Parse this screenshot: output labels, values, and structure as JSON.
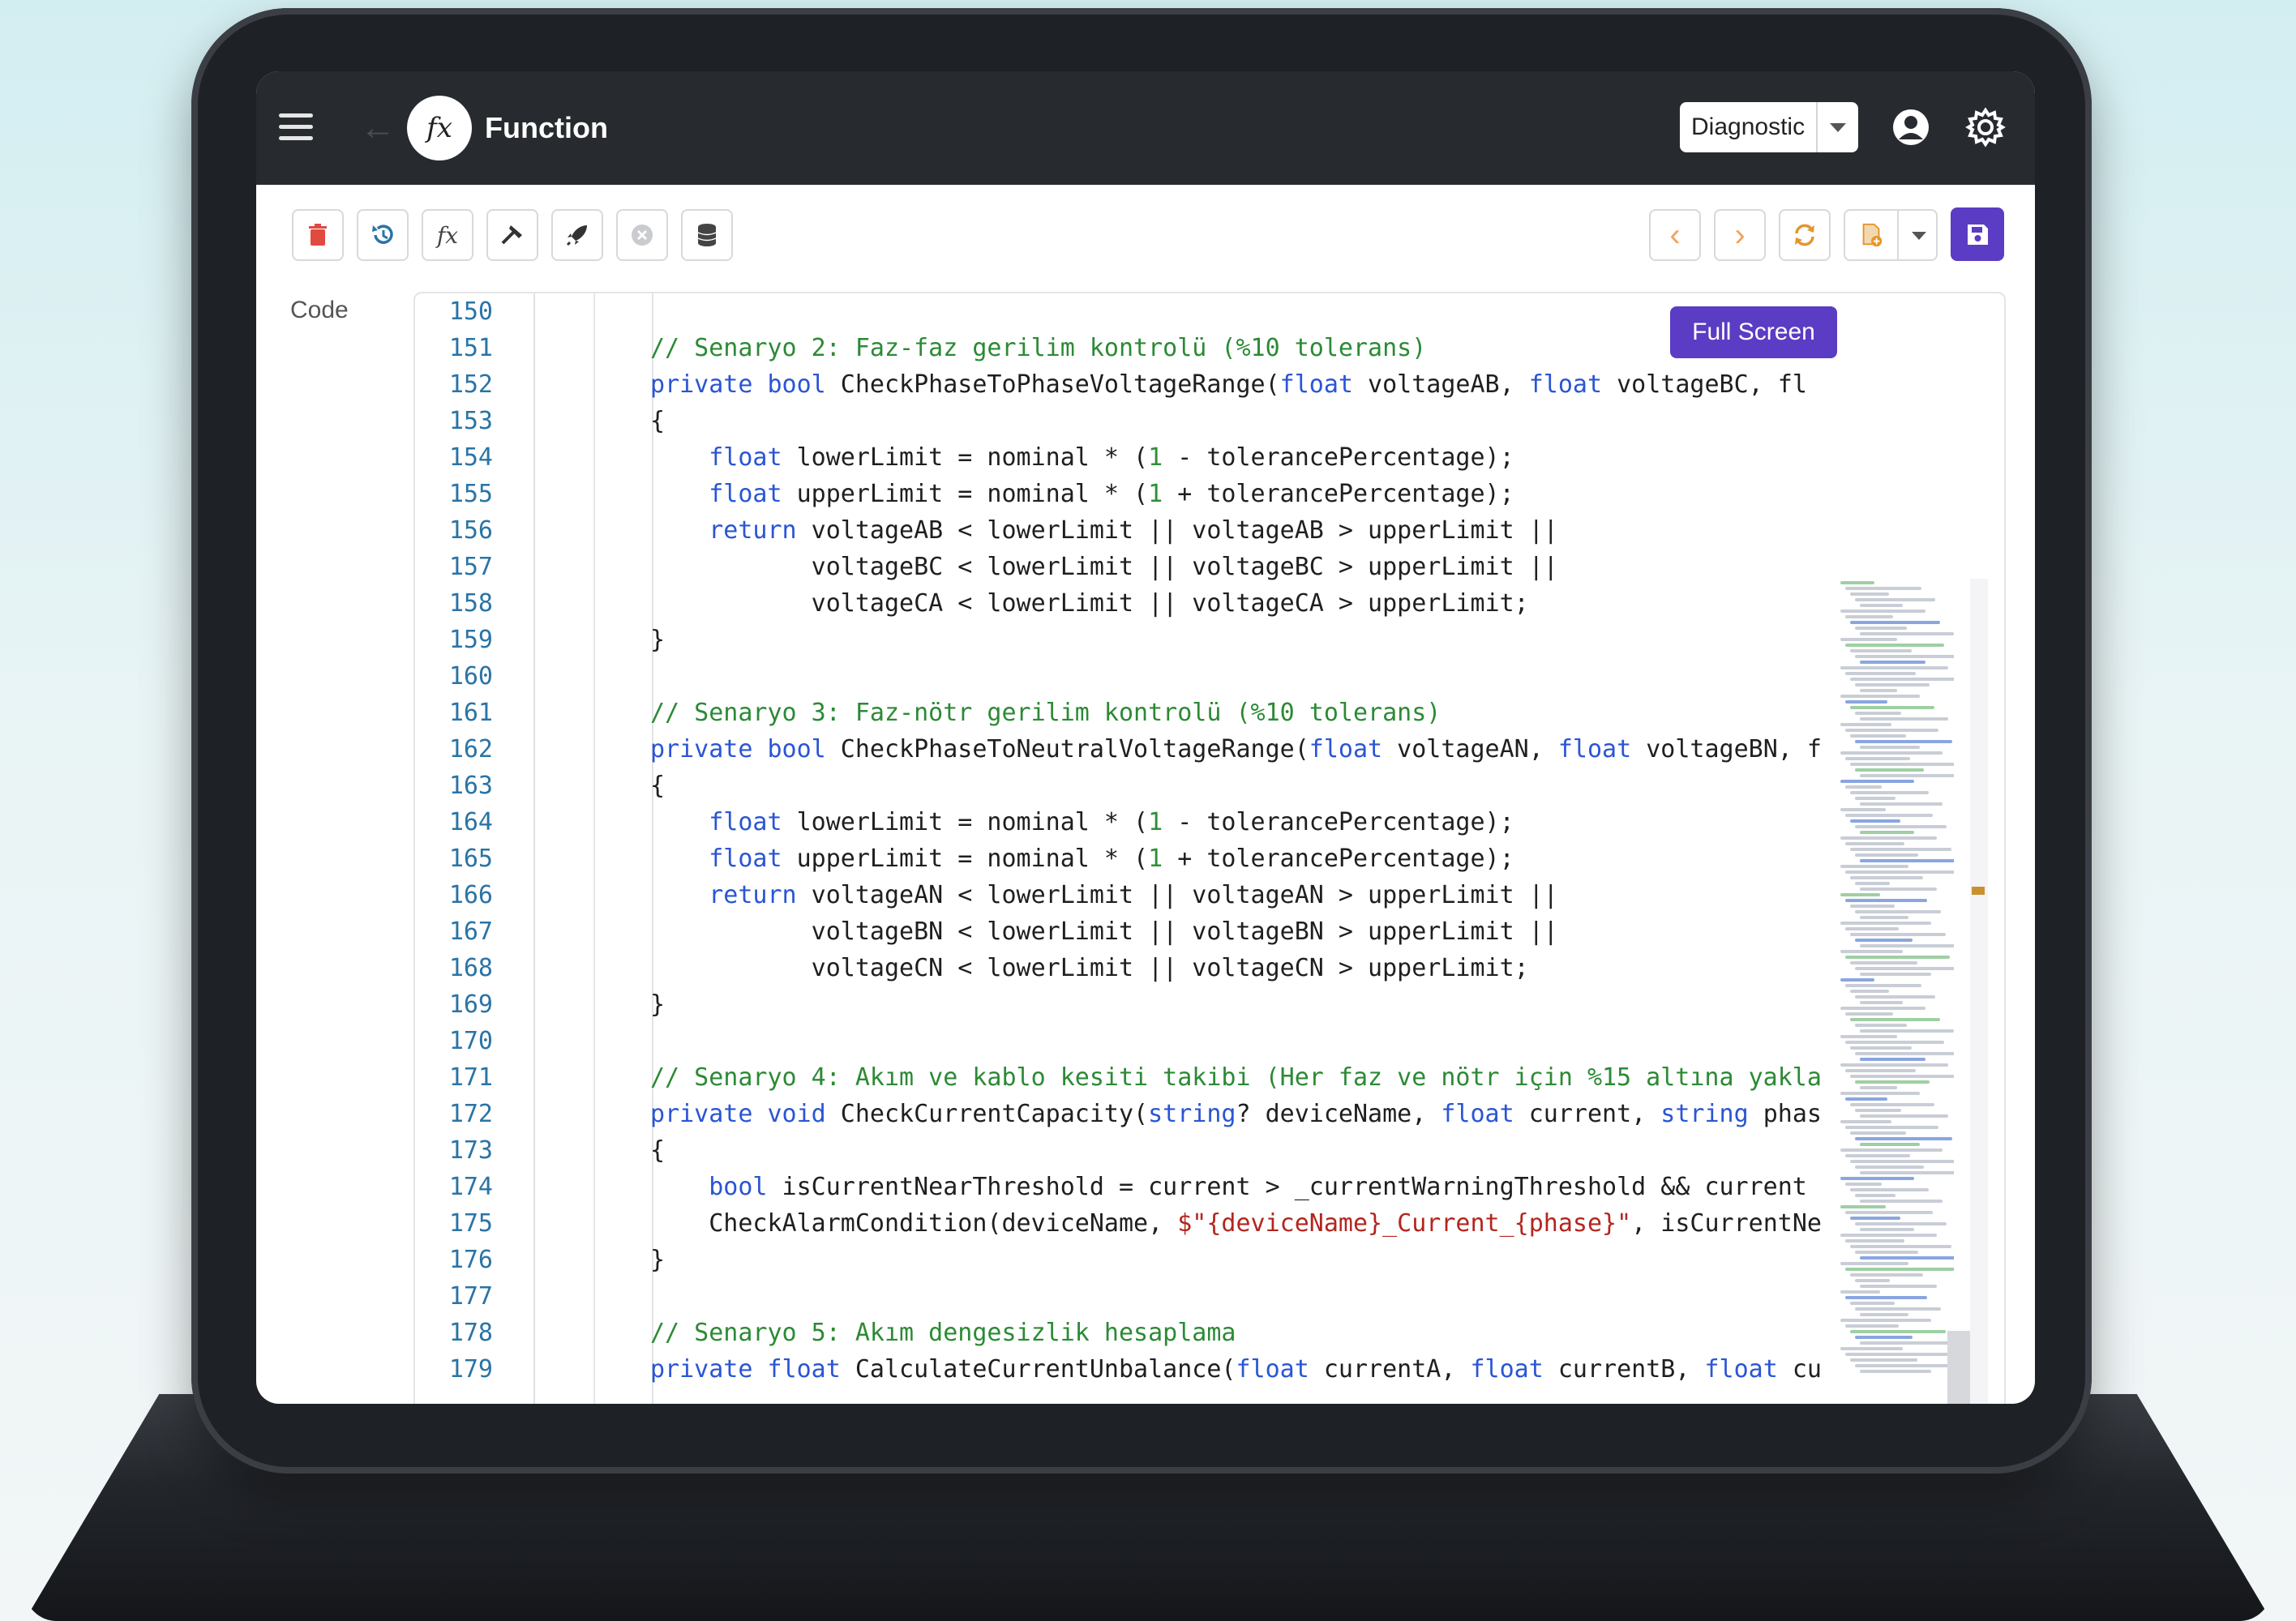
{
  "app": {
    "title": "Function",
    "logo_text": "fx"
  },
  "header": {
    "mode_selector": {
      "value": "Diagnostic"
    }
  },
  "toolbar": {
    "left_buttons": [
      "delete-icon",
      "undo-icon",
      "function-icon",
      "hammer-icon",
      "rocket-icon",
      "cancel-icon",
      "database-icon"
    ],
    "right_buttons": [
      "previous-icon",
      "next-icon",
      "refresh-icon",
      "add-file-icon",
      "save-icon"
    ],
    "colors": {
      "delete": "#e04a3f",
      "undo": "#2a74a6",
      "nav": "#f0a35c",
      "save": "#5b3cc4"
    }
  },
  "editor": {
    "label": "Code",
    "fullscreen_label": "Full Screen",
    "lines": [
      {
        "num": "150",
        "text": ""
      },
      {
        "num": "151",
        "text": "// Senaryo 2: Faz-faz gerilim kontrolü (%10 tolerans)"
      },
      {
        "num": "152",
        "text": "private bool CheckPhaseToPhaseVoltageRange(float voltageAB, float voltageBC, fl"
      },
      {
        "num": "153",
        "text": "{"
      },
      {
        "num": "154",
        "text": "    float lowerLimit = nominal * (1 - tolerancePercentage);"
      },
      {
        "num": "155",
        "text": "    float upperLimit = nominal * (1 + tolerancePercentage);"
      },
      {
        "num": "156",
        "text": "    return voltageAB < lowerLimit || voltageAB > upperLimit ||"
      },
      {
        "num": "157",
        "text": "           voltageBC < lowerLimit || voltageBC > upperLimit ||"
      },
      {
        "num": "158",
        "text": "           voltageCA < lowerLimit || voltageCA > upperLimit;"
      },
      {
        "num": "159",
        "text": "}"
      },
      {
        "num": "160",
        "text": ""
      },
      {
        "num": "161",
        "text": "// Senaryo 3: Faz-nötr gerilim kontrolü (%10 tolerans)"
      },
      {
        "num": "162",
        "text": "private bool CheckPhaseToNeutralVoltageRange(float voltageAN, float voltageBN, f"
      },
      {
        "num": "163",
        "text": "{"
      },
      {
        "num": "164",
        "text": "    float lowerLimit = nominal * (1 - tolerancePercentage);"
      },
      {
        "num": "165",
        "text": "    float upperLimit = nominal * (1 + tolerancePercentage);"
      },
      {
        "num": "166",
        "text": "    return voltageAN < lowerLimit || voltageAN > upperLimit ||"
      },
      {
        "num": "167",
        "text": "           voltageBN < lowerLimit || voltageBN > upperLimit ||"
      },
      {
        "num": "168",
        "text": "           voltageCN < lowerLimit || voltageCN > upperLimit;"
      },
      {
        "num": "169",
        "text": "}"
      },
      {
        "num": "170",
        "text": ""
      },
      {
        "num": "171",
        "text": "// Senaryo 4: Akım ve kablo kesiti takibi (Her faz ve nötr için %15 altına yakla"
      },
      {
        "num": "172",
        "text": "private void CheckCurrentCapacity(string? deviceName, float current, string phas"
      },
      {
        "num": "173",
        "text": "{"
      },
      {
        "num": "174",
        "text": "    bool isCurrentNearThreshold = current > _currentWarningThreshold && current"
      },
      {
        "num": "175",
        "text": "    CheckAlarmCondition(deviceName, $\"{deviceName}_Current_{phase}\", isCurrentNe"
      },
      {
        "num": "176",
        "text": "}"
      },
      {
        "num": "177",
        "text": ""
      },
      {
        "num": "178",
        "text": "// Senaryo 5: Akım dengesizlik hesaplama"
      },
      {
        "num": "179",
        "text": "private float CalculateCurrentUnbalance(float currentA, float currentB, float cu"
      }
    ]
  }
}
